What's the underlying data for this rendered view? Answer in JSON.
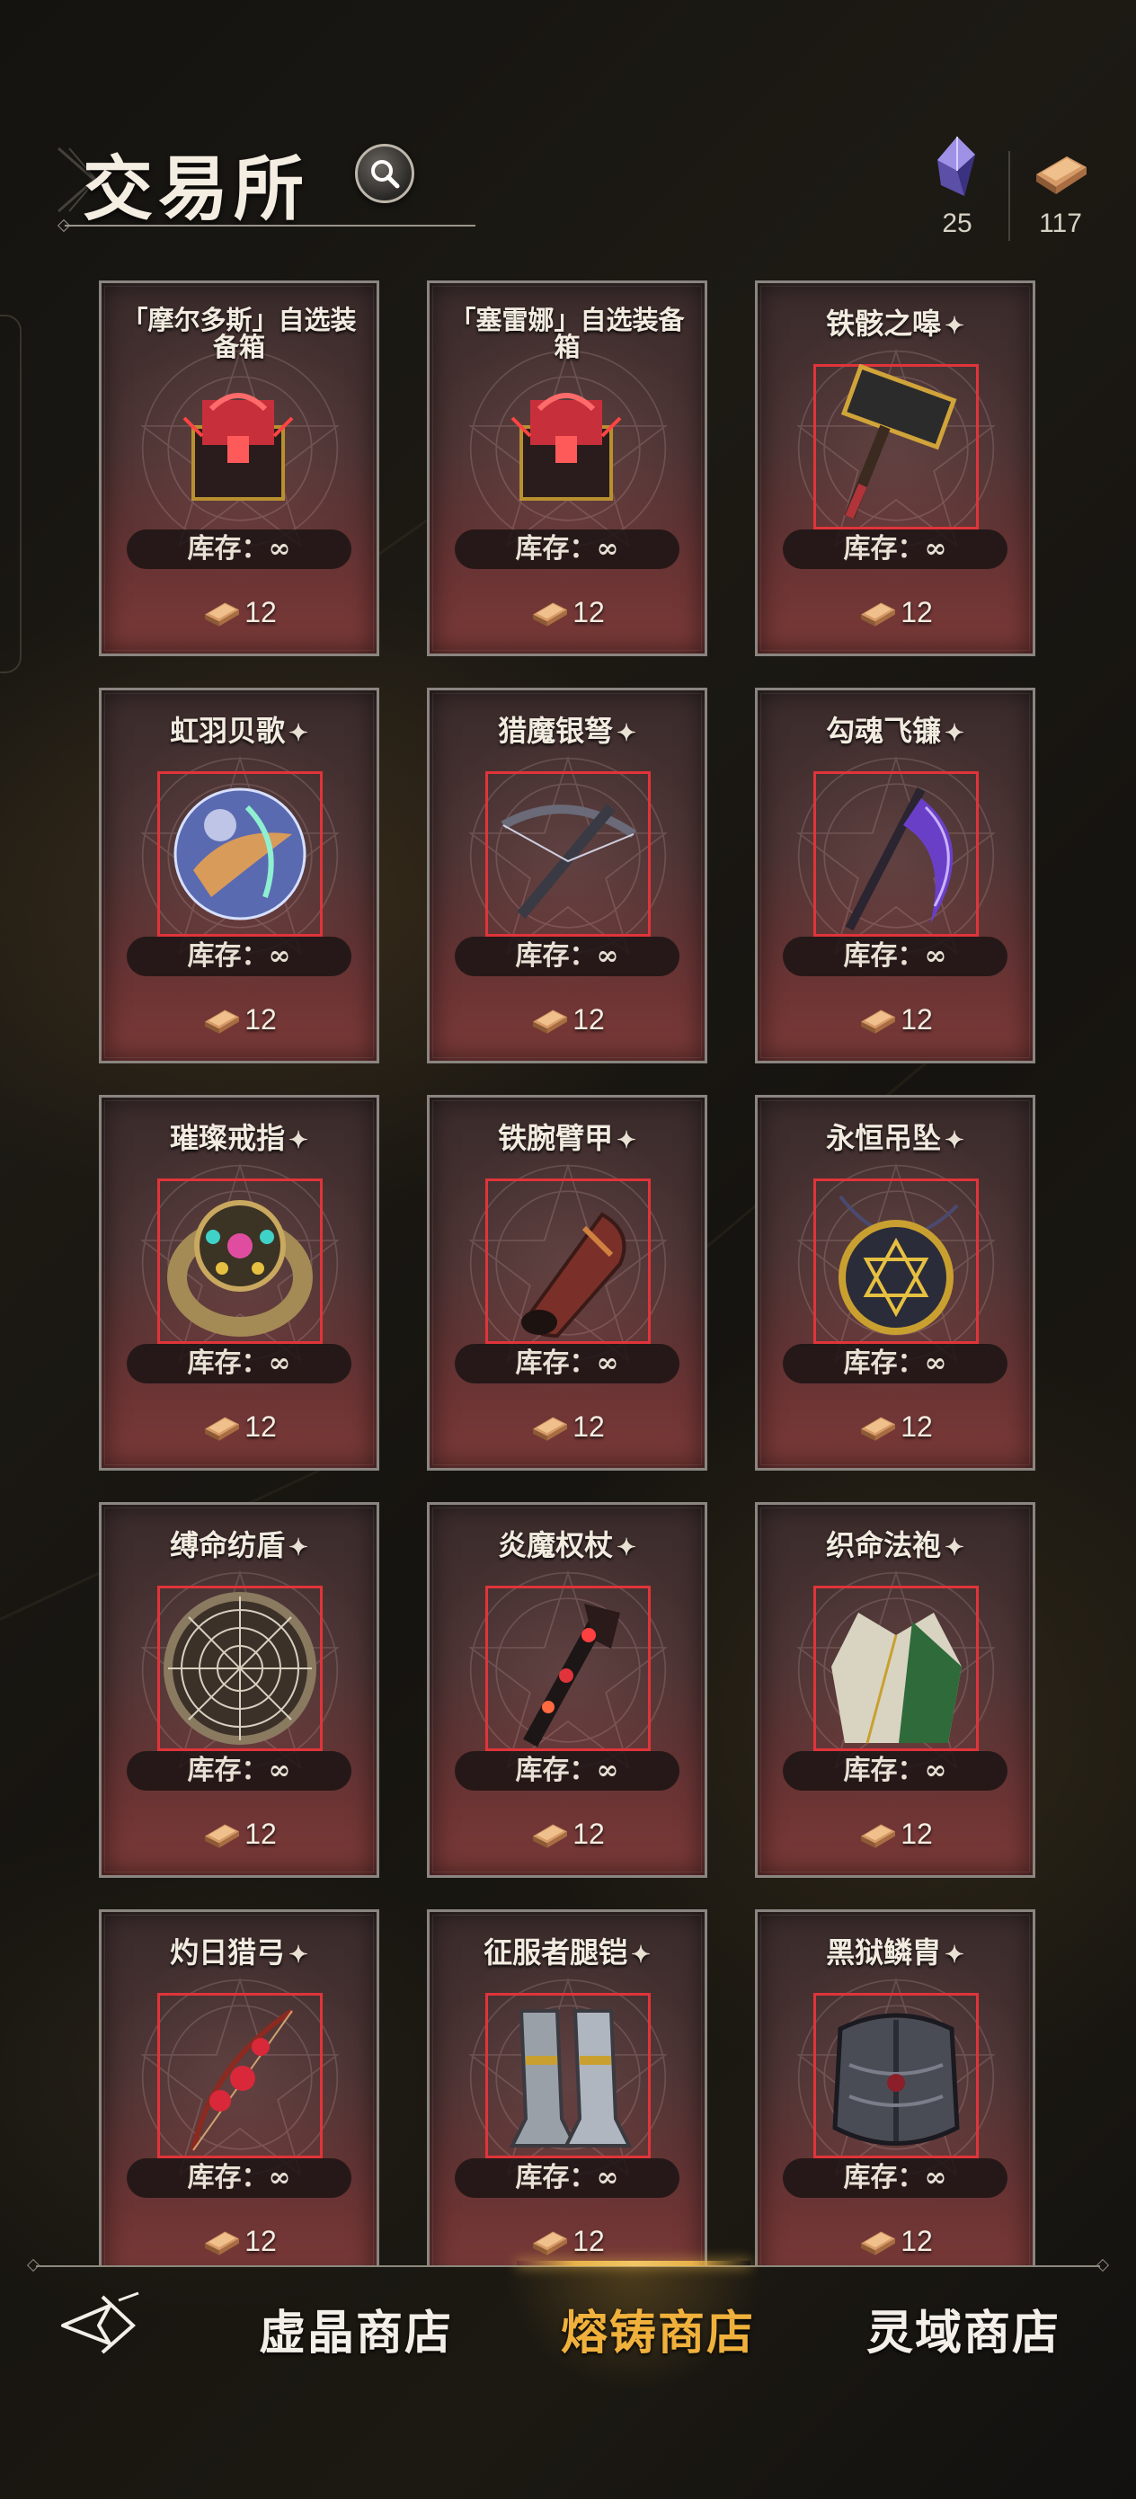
{
  "header": {
    "title": "交易所"
  },
  "currencies": [
    {
      "icon": "crystal-icon",
      "value": "25"
    },
    {
      "icon": "ingot-icon",
      "value": "117"
    }
  ],
  "stock_label": "库存：∞",
  "items": [
    {
      "name": "「摩尔多斯」自选装备箱",
      "price": "12",
      "icon": "red-chest-icon"
    },
    {
      "name": "「塞雷娜」自选装备箱",
      "price": "12",
      "icon": "red-chest-icon"
    },
    {
      "name": "铁骸之嗥",
      "price": "12",
      "icon": "hammer-icon"
    },
    {
      "name": "虹羽贝歌",
      "price": "12",
      "icon": "orb-icon"
    },
    {
      "name": "猎魔银弩",
      "price": "12",
      "icon": "crossbow-icon"
    },
    {
      "name": "勾魂飞镰",
      "price": "12",
      "icon": "scythe-icon"
    },
    {
      "name": "璀璨戒指",
      "price": "12",
      "icon": "ring-icon"
    },
    {
      "name": "铁腕臂甲",
      "price": "12",
      "icon": "bracer-icon"
    },
    {
      "name": "永恒吊坠",
      "price": "12",
      "icon": "pendant-icon"
    },
    {
      "name": "缚命纺盾",
      "price": "12",
      "icon": "web-shield-icon"
    },
    {
      "name": "炎魔权杖",
      "price": "12",
      "icon": "scepter-icon"
    },
    {
      "name": "织命法袍",
      "price": "12",
      "icon": "robe-icon"
    },
    {
      "name": "灼日猎弓",
      "price": "12",
      "icon": "bow-icon"
    },
    {
      "name": "征服者腿铠",
      "price": "12",
      "icon": "greaves-icon"
    },
    {
      "name": "黑狱鳞胄",
      "price": "12",
      "icon": "chestplate-icon"
    }
  ],
  "nav": {
    "tabs": [
      {
        "label": "虚晶商店",
        "active": false
      },
      {
        "label": "熔铸商店",
        "active": true
      },
      {
        "label": "灵域商店",
        "active": false
      }
    ]
  },
  "colors": {
    "active_tab": "#f0b13c",
    "item_frame": "#e0343a",
    "card_bg": "#4b3232"
  }
}
